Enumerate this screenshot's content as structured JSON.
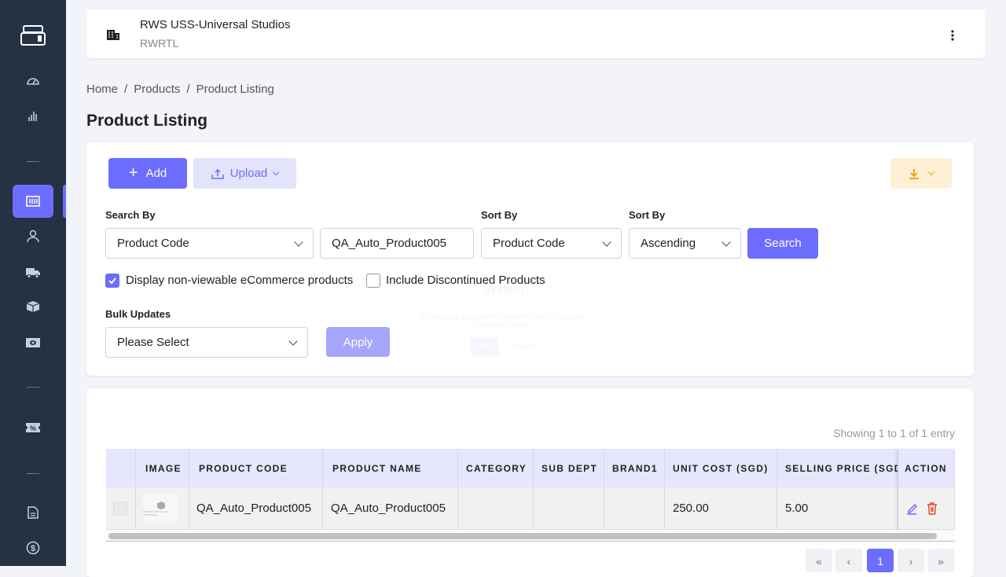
{
  "header": {
    "store_name": "RWS USS-Universal Studios",
    "store_code": "RWRTL"
  },
  "breadcrumb": [
    "Home",
    "Products",
    "Product Listing"
  ],
  "page_title": "Product Listing",
  "toolbar": {
    "add_label": "Add",
    "upload_label": "Upload"
  },
  "search": {
    "search_by_label": "Search By",
    "search_by_value": "Product Code",
    "search_value": "QA_Auto_Product005",
    "sort_by_label": "Sort By",
    "sort_by_value": "Product Code",
    "order_label": "Sort By",
    "order_value": "Ascending",
    "search_button": "Search"
  },
  "filters": {
    "non_viewable_label": "Display non-viewable eCommerce products",
    "non_viewable_checked": true,
    "discontinued_label": "Include Discontinued Products",
    "discontinued_checked": false
  },
  "bulk": {
    "label": "Bulk Updates",
    "value": "Please Select",
    "apply_label": "Apply"
  },
  "modal": {
    "title": "System",
    "message": "Are you sure you want to delete this item? This action cannot be undone.",
    "yes": "Yes",
    "cancel": "Cancel"
  },
  "table": {
    "showing": "Showing 1 to 1 of 1 entry",
    "columns": [
      "IMAGE",
      "PRODUCT CODE",
      "PRODUCT NAME",
      "CATEGORY",
      "SUB DEPT",
      "BRAND1",
      "UNIT COST (SGD)",
      "SELLING PRICE (SGD)",
      "ACTION"
    ],
    "rows": [
      {
        "image_text": "PRODUCT IMAGE NOT APPLICABLE",
        "code": "QA_Auto_Product005",
        "name": "QA_Auto_Product005",
        "category": "",
        "sub_dept": "",
        "brand1": "",
        "unit_cost": "250.00",
        "selling_price": "5.00"
      }
    ]
  },
  "pagination": {
    "first": "«",
    "prev": "‹",
    "current": "1",
    "next": "›",
    "last": "»"
  },
  "colors": {
    "accent": "#6c6cff",
    "sidebar": "#243244",
    "delete": "#e8442c"
  }
}
